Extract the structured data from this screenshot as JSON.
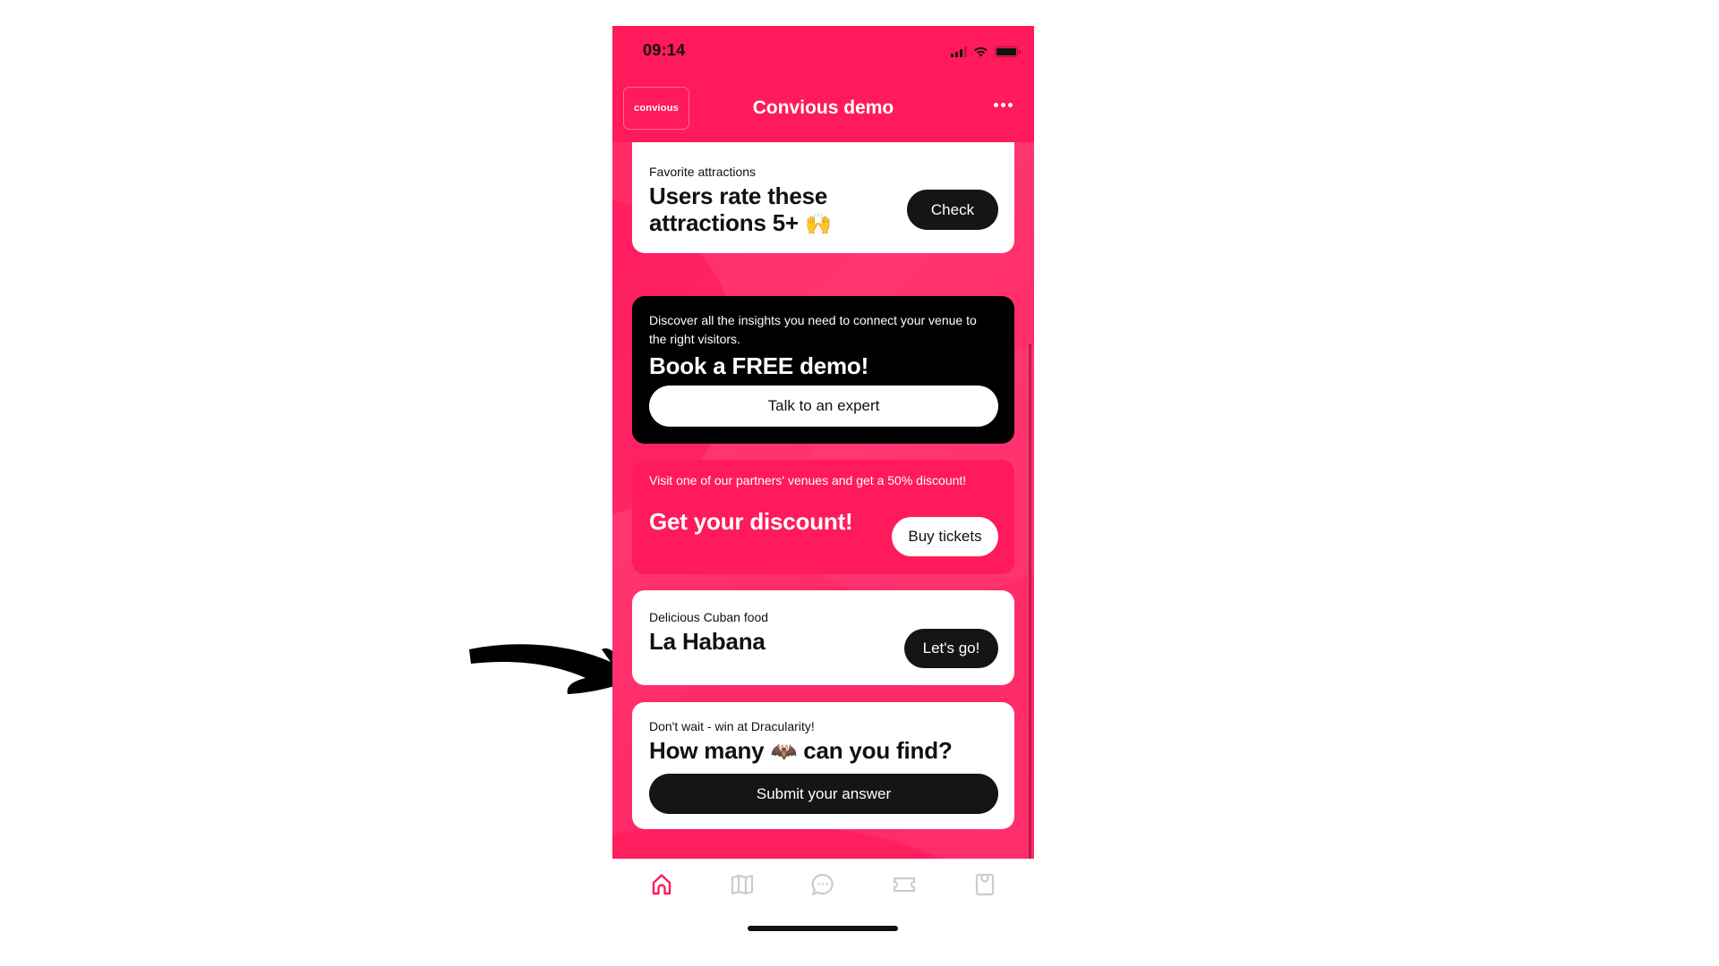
{
  "status_bar": {
    "time": "09:14",
    "icons": [
      "signal-icon",
      "wifi-icon",
      "battery-icon"
    ]
  },
  "header": {
    "logo_text": "convious",
    "title": "Convious demo",
    "more_icon": "more-horizontal-icon"
  },
  "cards": [
    {
      "eyebrow": "Favorite attractions",
      "title": "Users rate these attractions 5+",
      "emoji": "🙌",
      "button": "Check"
    },
    {
      "eyebrow": "Discover all the insights you need to connect your venue to the right visitors.",
      "title": "Book a FREE demo!",
      "button": "Talk to an expert"
    },
    {
      "eyebrow": "Visit one of our partners' venues and get a 50% discount!",
      "title": "Get your discount!",
      "button": "Buy tickets"
    },
    {
      "eyebrow": "Delicious Cuban food",
      "title": "La Habana",
      "button": "Let's go!"
    },
    {
      "eyebrow": "Don't wait -  win at Dracularity!",
      "title_before": "How many",
      "emoji": "🦇",
      "title_after": "can you find?",
      "button": "Submit your answer"
    }
  ],
  "tab_bar": {
    "active": "home",
    "tabs": [
      {
        "name": "home",
        "icon": "home-icon"
      },
      {
        "name": "map",
        "icon": "map-icon"
      },
      {
        "name": "chat",
        "icon": "chat-bubble-icon"
      },
      {
        "name": "tickets",
        "icon": "ticket-icon"
      },
      {
        "name": "shop",
        "icon": "shopping-bag-icon"
      }
    ]
  },
  "colors": {
    "brand_pink": "#ff1a5b",
    "active_tab": "#ff1a5b",
    "inactive_tab": "#cccccc",
    "dark_button": "#151515"
  },
  "annotation": {
    "icon": "arrow-pointing-right-icon"
  }
}
